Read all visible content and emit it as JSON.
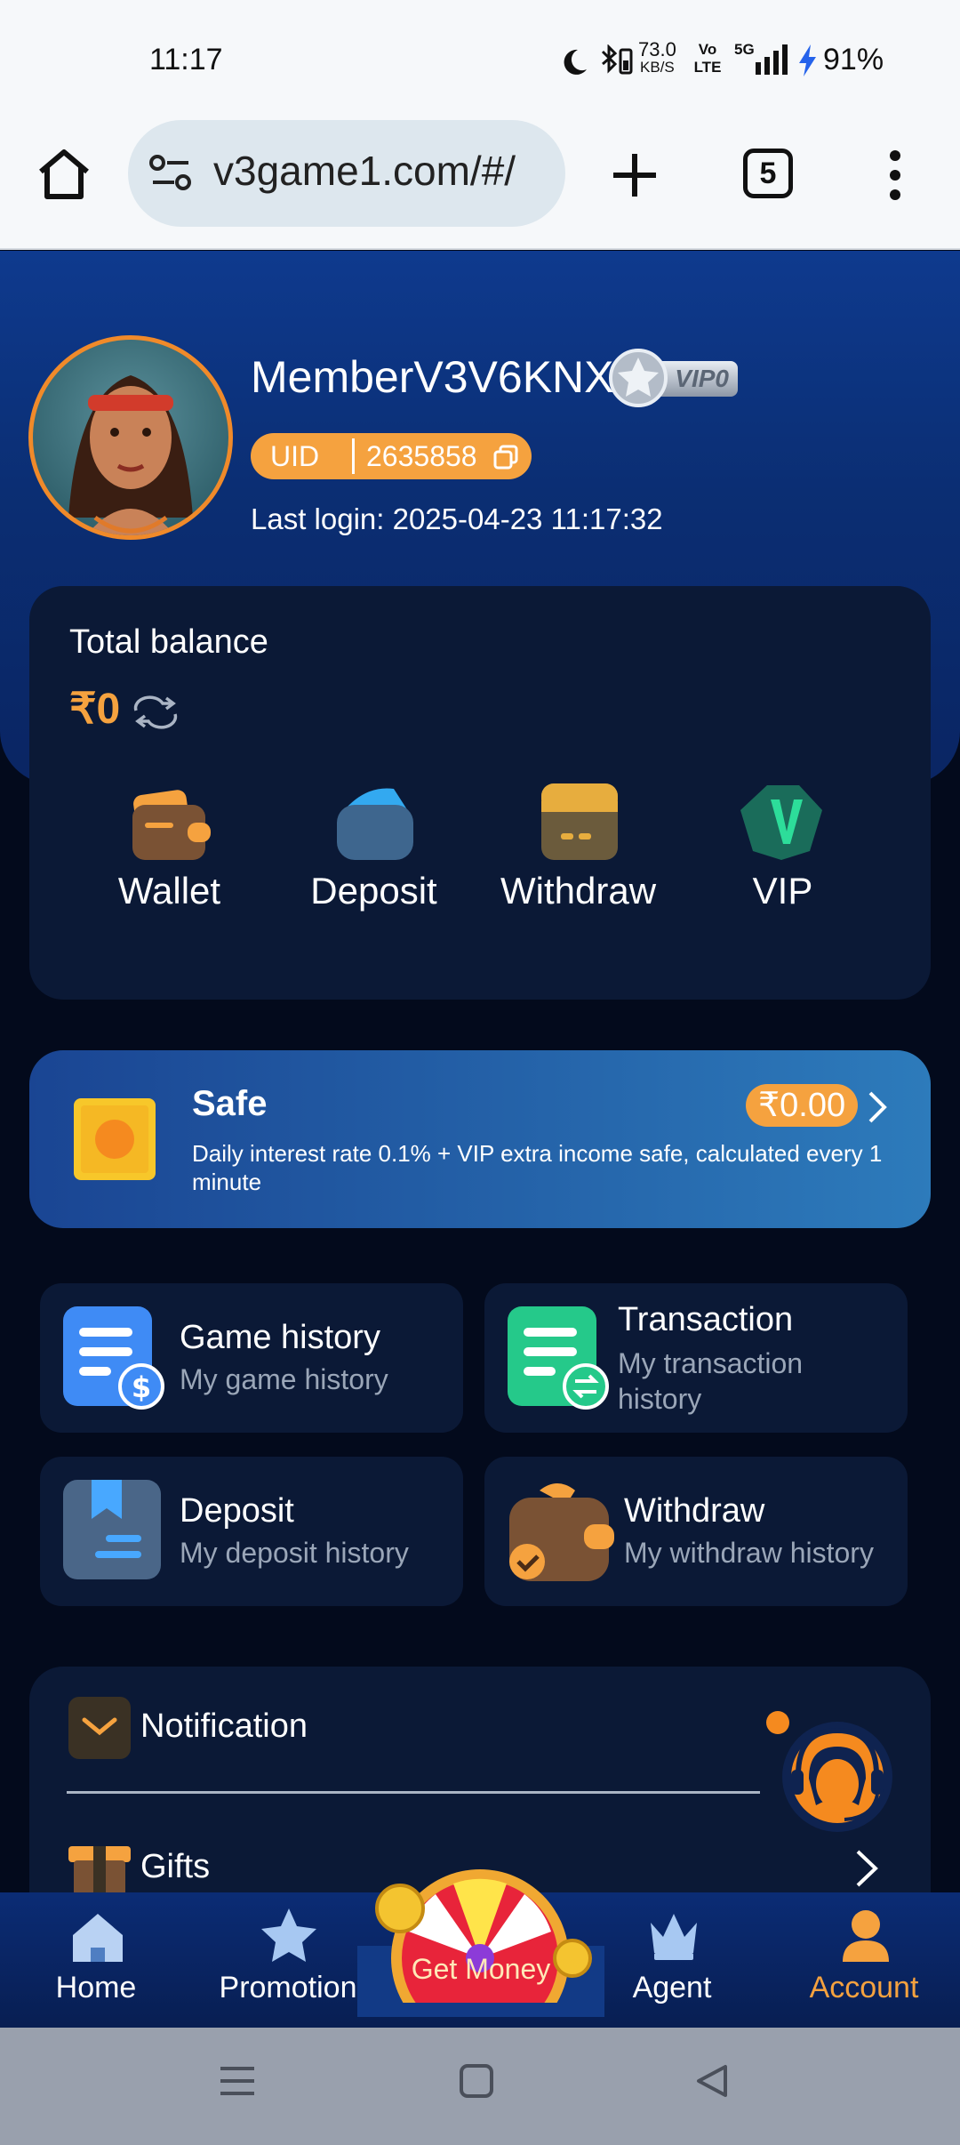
{
  "status_bar": {
    "time": "11:17",
    "net_speed_value": "73.0",
    "net_speed_unit": "KB/S",
    "volte": "Vo LTE",
    "signal_label": "5G",
    "battery": "91%"
  },
  "browser": {
    "url": "v3game1.com/#/",
    "tab_count": "5"
  },
  "profile": {
    "username": "MemberV3V6KNX",
    "vip_badge": "VIP0",
    "uid_label": "UID",
    "uid_value": "2635858",
    "last_login": "Last login: 2025-04-23 11:17:32"
  },
  "balance": {
    "label": "Total balance",
    "amount": "₹0"
  },
  "quick_actions": [
    {
      "label": "Wallet"
    },
    {
      "label": "Deposit"
    },
    {
      "label": "Withdraw"
    },
    {
      "label": "VIP"
    }
  ],
  "safe": {
    "title": "Safe",
    "amount": "₹0.00",
    "description": "Daily interest rate 0.1% + VIP extra income safe, calculated every 1 minute"
  },
  "history_tiles": [
    {
      "title": "Game history",
      "subtitle": "My game history"
    },
    {
      "title": "Transaction",
      "subtitle": "My transaction history"
    },
    {
      "title": "Deposit",
      "subtitle": "My deposit history"
    },
    {
      "title": "Withdraw",
      "subtitle": "My withdraw history"
    }
  ],
  "menu": {
    "notification": "Notification",
    "gifts": "Gifts"
  },
  "bottom_nav": {
    "home": "Home",
    "promotion": "Promotion",
    "get_money": "Get Money",
    "agent": "Agent",
    "account": "Account"
  },
  "colors": {
    "accent_orange": "#f5a23f",
    "hero_blue": "#0e3a8e",
    "card_bg": "#0b1936",
    "page_bg": "#030a1c",
    "safe_gradient_start": "#1a4593",
    "safe_gradient_end": "#2d7bbb"
  }
}
